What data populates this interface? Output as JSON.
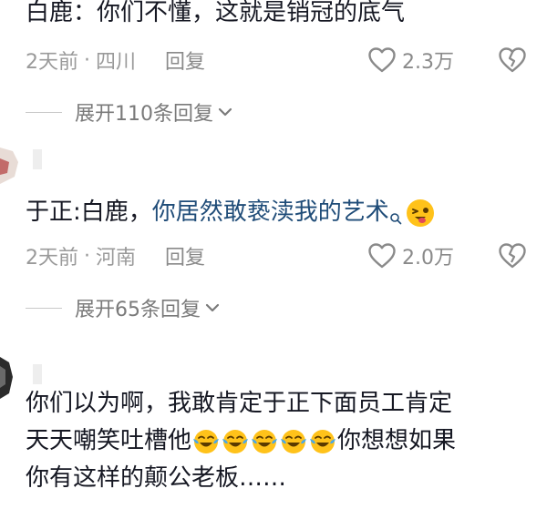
{
  "comments": [
    {
      "text": "白鹿：你们不懂，这就是销冠的底气",
      "time": "2天前",
      "sep": "·",
      "location": "四川",
      "reply": "回复",
      "likes": "2.3万",
      "expand": "展开110条回复"
    },
    {
      "text_prefix": "于正:白鹿，",
      "text_link": "你居然敢亵渎我的艺术",
      "time": "2天前",
      "sep": "·",
      "location": "河南",
      "reply": "回复",
      "likes": "2.0万",
      "expand": "展开65条回复"
    },
    {
      "line1": "你们以为啊，我敢肯定于正下面员工肯定",
      "line2_prefix": "天天嘲笑吐槽他",
      "line2_suffix": "你想想如果",
      "line3": "你有这样的颠公老板……",
      "emoji_count": 5
    }
  ],
  "colors": {
    "text": "#161823",
    "meta": "#9a9a9a",
    "link": "#1f4c78"
  },
  "icons": [
    "heart-icon",
    "broken-heart-icon",
    "chevron-down-icon",
    "search-icon",
    "wink-emoji-icon",
    "laugh-cry-emoji-icon"
  ]
}
